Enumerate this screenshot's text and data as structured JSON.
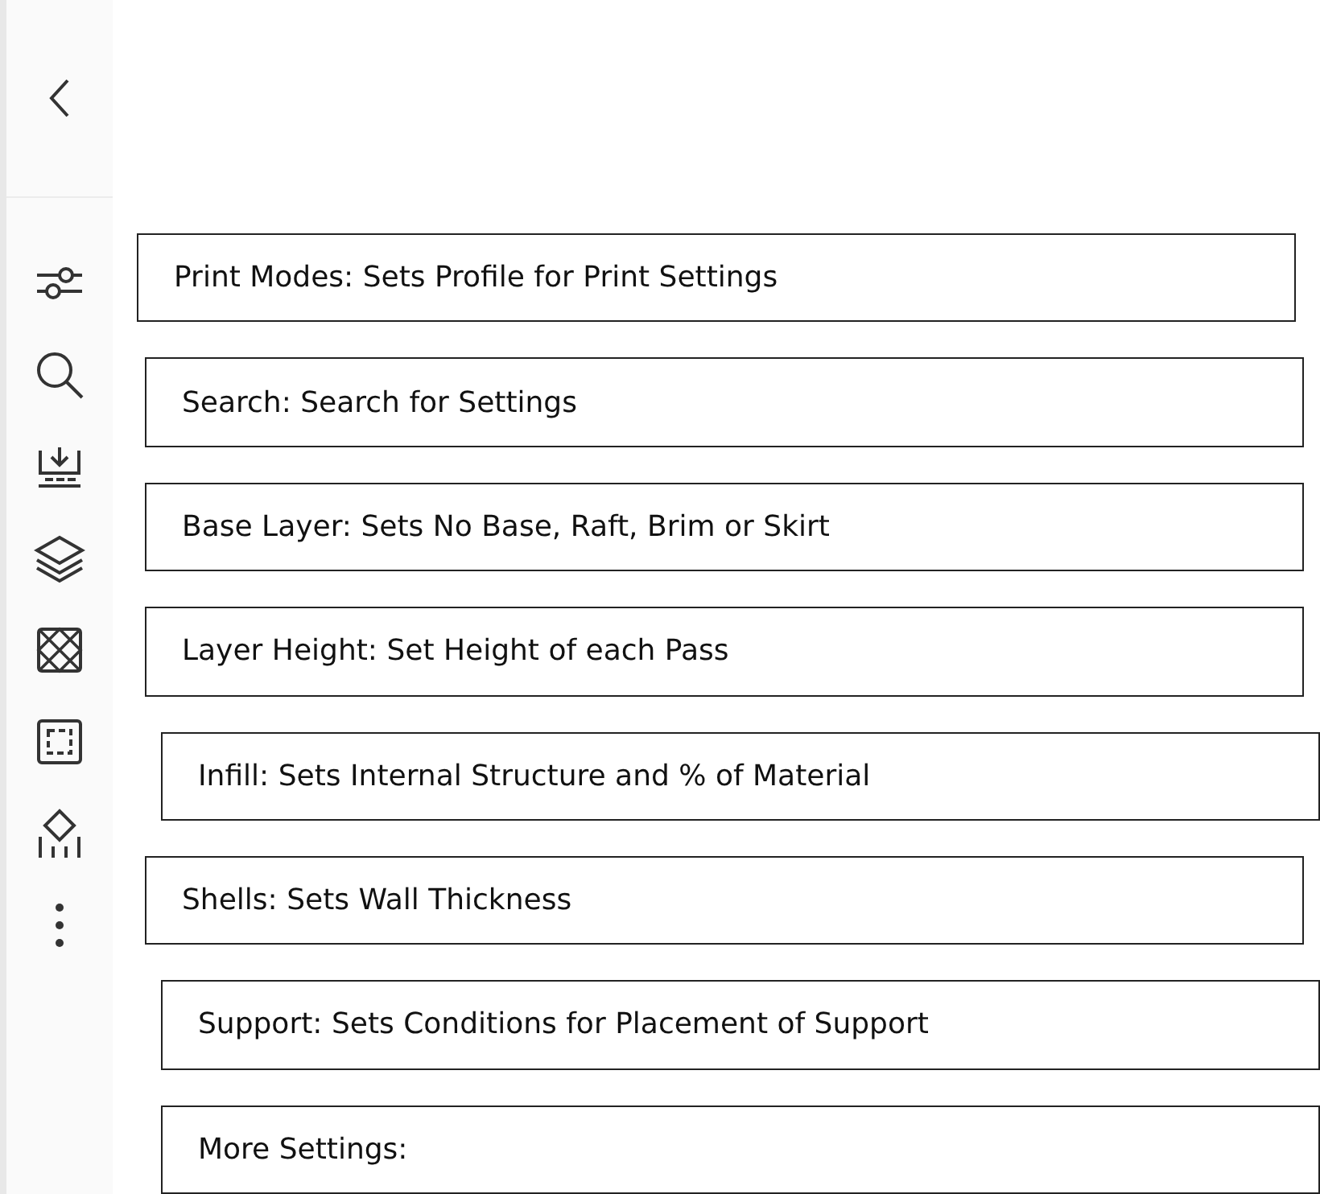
{
  "sidebar": {
    "items": [
      {
        "kind": "sliders"
      },
      {
        "kind": "search"
      },
      {
        "kind": "base"
      },
      {
        "kind": "layers"
      },
      {
        "kind": "infill"
      },
      {
        "kind": "shells"
      },
      {
        "kind": "support"
      },
      {
        "kind": "more"
      }
    ]
  },
  "callouts": [
    {
      "text": "Print Modes: Sets  Profile for Print Settings"
    },
    {
      "text": "Search: Search for Settings"
    },
    {
      "text": "Base Layer: Sets No Base, Raft, Brim or Skirt"
    },
    {
      "text": "Layer Height: Set Height of each Pass"
    },
    {
      "text": "Infill: Sets Internal Structure and % of Material"
    },
    {
      "text": "Shells: Sets Wall Thickness"
    },
    {
      "text": "Support: Sets Conditions for Placement of Support"
    },
    {
      "text": "More Settings:"
    }
  ]
}
